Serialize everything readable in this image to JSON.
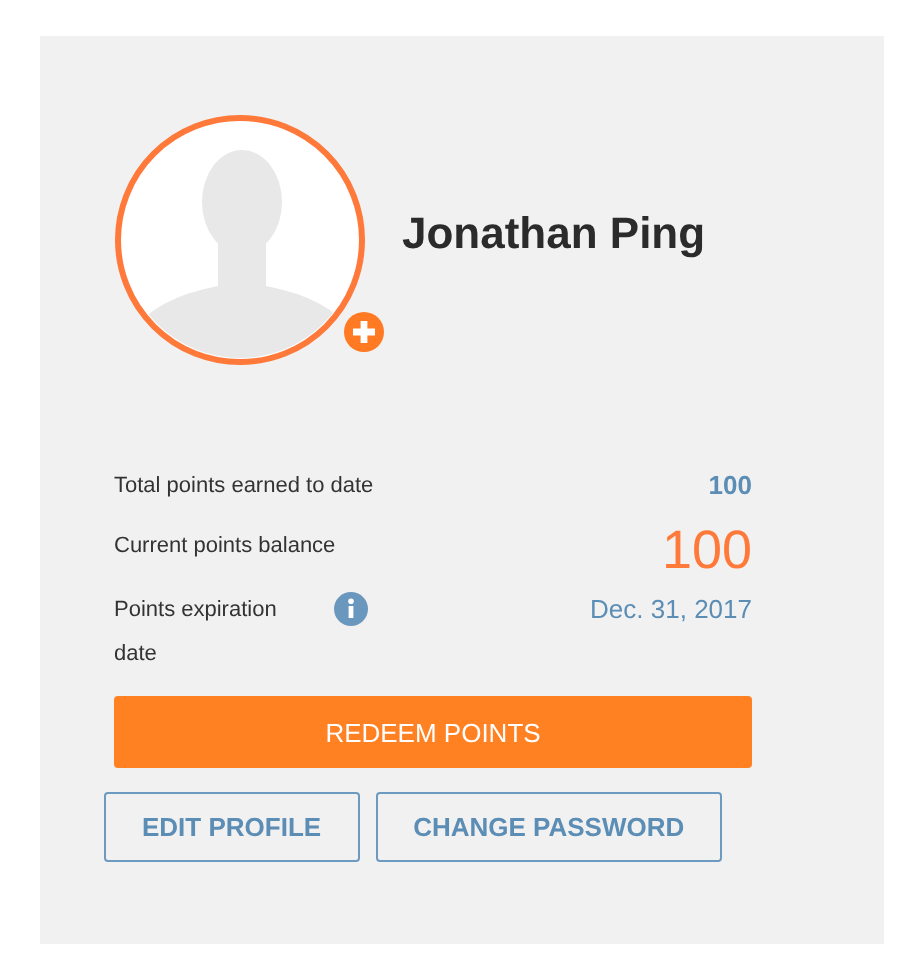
{
  "profile": {
    "name": "Jonathan Ping"
  },
  "stats": [
    {
      "kind": "earned",
      "label": "Total points earned to date",
      "value": "100"
    },
    {
      "kind": "balance",
      "label": "Current points balance",
      "value": "100"
    },
    {
      "kind": "expiry",
      "label": "Points expiration date",
      "value": "Dec. 31, 2017",
      "info": true
    }
  ],
  "buttons": [
    {
      "kind": "primary",
      "label": "REDEEM POINTS"
    },
    {
      "kind": "outline",
      "label": "EDIT PROFILE"
    },
    {
      "kind": "outline",
      "label": "CHANGE PASSWORD"
    }
  ]
}
